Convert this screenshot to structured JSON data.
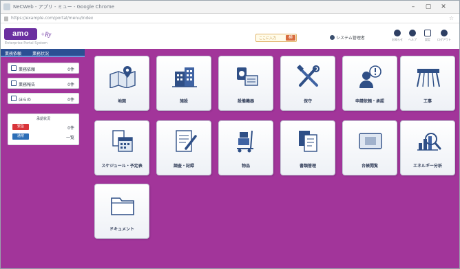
{
  "window": {
    "title": "NeCWeb - アプリ - ミュー - Google Chrome",
    "url": "https://example.com/portal/menu/index"
  },
  "header": {
    "logo_text": "amo",
    "logo_sub": "+Ry",
    "logo_caption": "Enterprise Portal System",
    "search_placeholder": "ここに入力",
    "search_button": "検",
    "user_name": "システム管理者",
    "icons": [
      {
        "label": "お知らせ",
        "icon": "bell-icon"
      },
      {
        "label": "ヘルプ",
        "icon": "help-icon"
      },
      {
        "label": "設定",
        "icon": "gear-icon"
      },
      {
        "label": "ログアウト",
        "icon": "logout-icon"
      }
    ]
  },
  "sidebar": {
    "tabs": [
      "業務依頼",
      "業務状況"
    ],
    "items": [
      {
        "label": "業務依頼",
        "count": "0件",
        "icon": "checkbox-icon"
      },
      {
        "label": "業務報告",
        "count": "0件",
        "icon": "edit-icon"
      },
      {
        "label": "ほらの",
        "count": "0件",
        "icon": "list-icon"
      }
    ],
    "panel": {
      "title": "承認状況",
      "rows": [
        {
          "tag": "緊急",
          "value": "0件",
          "color": "#d9343a"
        },
        {
          "tag": "通常",
          "value": "一覧",
          "color": "#2d6fb7"
        }
      ]
    }
  },
  "tiles": [
    {
      "label": "地図",
      "icon": "map-pin-icon"
    },
    {
      "label": "施設",
      "icon": "building-icon"
    },
    {
      "label": "設備機器",
      "icon": "equipment-icon"
    },
    {
      "label": "保守",
      "icon": "tools-icon"
    },
    {
      "label": "申請依頼・承認",
      "icon": "person-alert-icon"
    },
    {
      "label": "工事",
      "icon": "construction-icon"
    },
    {
      "label": "スケジュール・予定表",
      "icon": "schedule-docs-icon"
    },
    {
      "label": "調査・記録",
      "icon": "report-edit-icon"
    },
    {
      "label": "物品",
      "icon": "cart-boxes-icon"
    },
    {
      "label": "書類管理",
      "icon": "documents-icon"
    },
    {
      "label": "台帳閲覧",
      "icon": "ledger-icon"
    },
    {
      "label": "エネルギー分析",
      "icon": "chart-magnify-icon"
    },
    {
      "label": "ドキュメント",
      "icon": "folder-icon"
    }
  ],
  "colors": {
    "background": "#a2359a",
    "brand": "#6b2fa0",
    "sidebar_tab": "#2b4f93"
  }
}
